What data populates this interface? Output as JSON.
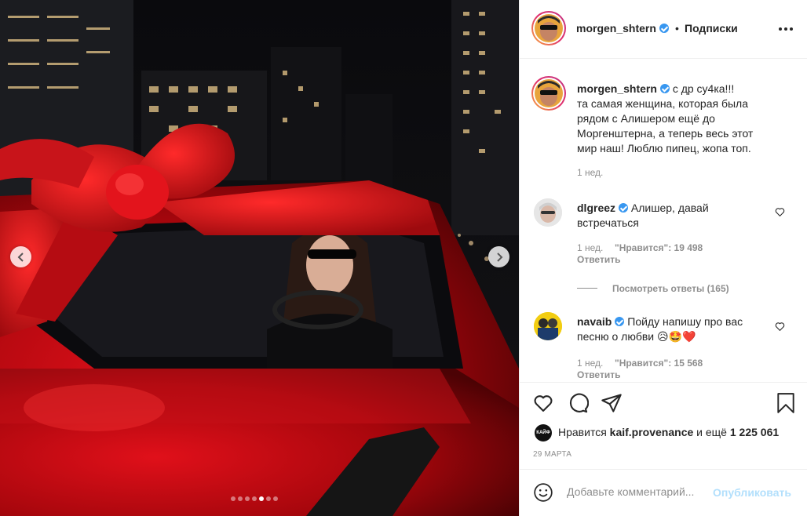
{
  "post": {
    "author": "morgen_shtern",
    "follow_label": "Подписки",
    "dot_separator": "•",
    "more_icon": "more-options-icon",
    "caption_lines": [
      "с др су4ка!!!",
      "та самая женщина, которая была",
      "рядом с Алишером ещё до",
      "Моргенштерна, а теперь весь этот",
      "мир наш! Люблю пипец, жопа топ."
    ],
    "caption_age": "1 нед.",
    "date": "29 МАРТА"
  },
  "comments": [
    {
      "username": "dlgreez",
      "text_lines": [
        "Алишер, давай",
        "встречаться"
      ],
      "age": "1 нед.",
      "likes_label": "\"Нравится\": 19 498",
      "reply_label": "Ответить",
      "view_replies_label": "Посмотреть ответы (165)"
    },
    {
      "username": "navaib",
      "text_lines": [
        "Пойду напишу про вас",
        "песню о любви"
      ],
      "emojis": [
        "😥",
        "🤩",
        "❤️"
      ],
      "age": "1 нед.",
      "likes_label": "\"Нравится\": 15 568",
      "reply_label": "Ответить"
    }
  ],
  "likes": {
    "prefix": "Нравится",
    "user": "kaif.provenance",
    "middle": "и ещё",
    "count": "1 225 061",
    "liker_avatar_text": "КАЙФ"
  },
  "add_comment": {
    "placeholder": "Добавьте комментарий...",
    "publish_label": "Опубликовать"
  },
  "carousel": {
    "total": 7,
    "active": 5
  },
  "colors": {
    "verified": "#3897f0",
    "text": "#262626",
    "muted": "#8e8e8e",
    "publish_disabled": "#b2dffc"
  }
}
